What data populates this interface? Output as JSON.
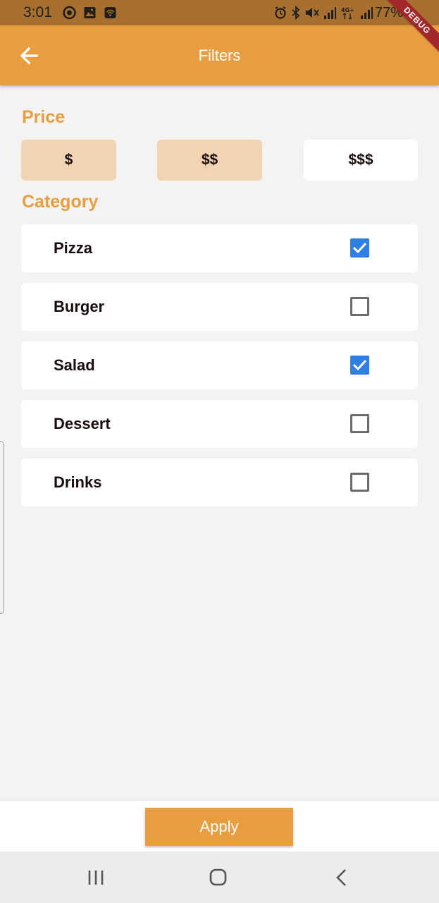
{
  "status_bar": {
    "time": "3:01",
    "battery": "77%",
    "left_icons": [
      "circle-a-icon",
      "image-icon",
      "wifi-calling-icon"
    ],
    "right_icons": [
      "alarm-icon",
      "bluetooth-icon",
      "mute-icon",
      "signal-icon",
      "4g-icon",
      "signal-icon"
    ]
  },
  "debug_banner": "DEBUG",
  "app_bar": {
    "title": "Filters",
    "back_icon": "arrow-left-icon"
  },
  "price": {
    "title": "Price",
    "options": [
      {
        "label": "$",
        "selected": true
      },
      {
        "label": "$$",
        "selected": true
      },
      {
        "label": "$$$",
        "selected": false
      }
    ]
  },
  "category": {
    "title": "Category",
    "items": [
      {
        "label": "Pizza",
        "checked": true
      },
      {
        "label": "Burger",
        "checked": false
      },
      {
        "label": "Salad",
        "checked": true
      },
      {
        "label": "Dessert",
        "checked": false
      },
      {
        "label": "Drinks",
        "checked": false
      }
    ]
  },
  "footer": {
    "apply_label": "Apply"
  },
  "nav_bar": {
    "icons": [
      "recent-apps-icon",
      "home-icon",
      "back-icon"
    ]
  },
  "colors": {
    "primary": "#e89e3f",
    "selected_chip": "#f2d3b2",
    "checkbox": "#2f80e4",
    "status_bar": "#a8702e"
  }
}
